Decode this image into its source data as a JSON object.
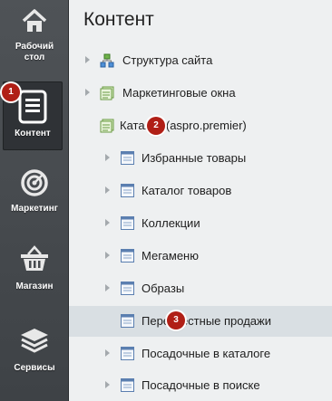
{
  "leftnav": {
    "items": [
      {
        "label_line1": "Рабочий",
        "label_line2": "стол",
        "icon": "home-icon"
      },
      {
        "label_line1": "Контент",
        "label_line2": "",
        "icon": "document-icon",
        "badge": "1"
      },
      {
        "label_line1": "Маркетинг",
        "label_line2": "",
        "icon": "target-icon"
      },
      {
        "label_line1": "Магазин",
        "label_line2": "",
        "icon": "basket-icon"
      },
      {
        "label_line1": "Сервисы",
        "label_line2": "",
        "icon": "layers-icon"
      }
    ]
  },
  "panel": {
    "title": "Контент",
    "tree": [
      {
        "label": "Структура сайта",
        "icon": "site-structure-icon",
        "level": 0
      },
      {
        "label": "Маркетинговые окна",
        "icon": "infoblock-type-icon",
        "level": 0
      },
      {
        "label": "Каталог (aspro.premier)",
        "icon": "infoblock-type-icon",
        "level": 0,
        "badge": "2"
      },
      {
        "label": "Избранные товары",
        "icon": "infoblock-icon",
        "level": 1
      },
      {
        "label": "Каталог товаров",
        "icon": "infoblock-icon",
        "level": 1
      },
      {
        "label": "Коллекции",
        "icon": "infoblock-icon",
        "level": 1
      },
      {
        "label": "Мегаменю",
        "icon": "infoblock-icon",
        "level": 1
      },
      {
        "label": "Образы",
        "icon": "infoblock-icon",
        "level": 1
      },
      {
        "label": "Перекрестные продажи",
        "icon": "infoblock-icon",
        "level": 1,
        "badge": "3",
        "selected": true
      },
      {
        "label": "Посадочные в каталоге",
        "icon": "infoblock-icon",
        "level": 1
      },
      {
        "label": "Посадочные в поиске",
        "icon": "infoblock-icon",
        "level": 1
      }
    ]
  },
  "colors": {
    "nav_bg": "#45494d",
    "badge": "#b01f16",
    "panel_bg": "#eef0f1",
    "selected_row": "#d9dfe3"
  }
}
